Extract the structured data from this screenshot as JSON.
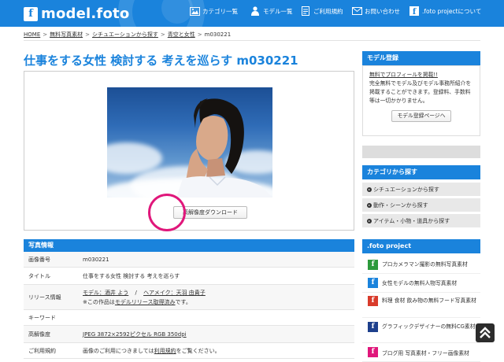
{
  "header": {
    "logo_mark": "f",
    "logo_text": "model.foto",
    "nav": [
      {
        "label": "カテゴリ一覧",
        "icon": "image-icon"
      },
      {
        "label": "モデル一覧",
        "icon": "person-icon"
      },
      {
        "label": "ご利用規約",
        "icon": "document-icon"
      },
      {
        "label": "お問い合わせ",
        "icon": "mail-icon"
      },
      {
        "label": ".foto projectについて",
        "icon": "foto-logo-icon"
      }
    ]
  },
  "breadcrumb": [
    "HOME",
    "無料写真素材",
    "シチュエーションから探す",
    "青空と女性",
    "m030221"
  ],
  "breadcrumb_sep": ">",
  "page_title": "仕事をする女性 検討する 考えを巡らす m030221",
  "download_button": "高解像度ダウンロード",
  "info": {
    "header": "写真情報",
    "rows": [
      {
        "label": "画像番号",
        "value": "m030221"
      },
      {
        "label": "タイトル",
        "value": "仕事をする女性 検討する 考えを巡らす"
      },
      {
        "label": "リリース情報",
        "model_link": "モデル：酒井 よう",
        "slash": "/",
        "hair_link": "ヘアメイク：天羽 由貴子",
        "note_prefix": "※この作品は",
        "note_link": "モデルリリース取得済み",
        "note_suffix": "です。"
      },
      {
        "label": "キーワード",
        "value": ""
      },
      {
        "label": "高解像度",
        "value": "JPEG 3872×2592ピクセル RGB 350dpi"
      },
      {
        "label": "ご利用規約",
        "prefix": "画像のご利用につきましては",
        "link": "利用規約",
        "suffix": "をご覧ください。"
      }
    ]
  },
  "sidebar": {
    "register": {
      "header": "モデル登録",
      "link": "無料でプロフィールを掲載!!",
      "text": "完全無料でモデル及びモデル事務所紹介を掲載することができます。登録料、手数料等は一切かかりません。",
      "button": "モデル登録ページへ"
    },
    "categories": {
      "header": "カテゴリから探す",
      "items": [
        "シチュエーションから探す",
        "動作・シーンから探す",
        "アイテム・小物・道具から探す"
      ]
    },
    "project": {
      "header": ".foto project",
      "items": [
        {
          "label": "プロカメラマン撮影の無料写真素材",
          "color": "#2c9a3c"
        },
        {
          "label": "女性モデルの無料人物写真素材",
          "color": "#1a83dc"
        },
        {
          "label": "料理 食材 飲み物の無料フード写真素材",
          "color": "#d93b2b"
        },
        {
          "label": "グラフィックデザイナーの無料CG素材",
          "color": "#1d3f8c"
        },
        {
          "label": "ブログ用 写真素材・フリー画像素材",
          "color": "#e0177b"
        }
      ]
    }
  },
  "colors": {
    "brand": "#1a83dc",
    "highlight": "#e0177b"
  }
}
